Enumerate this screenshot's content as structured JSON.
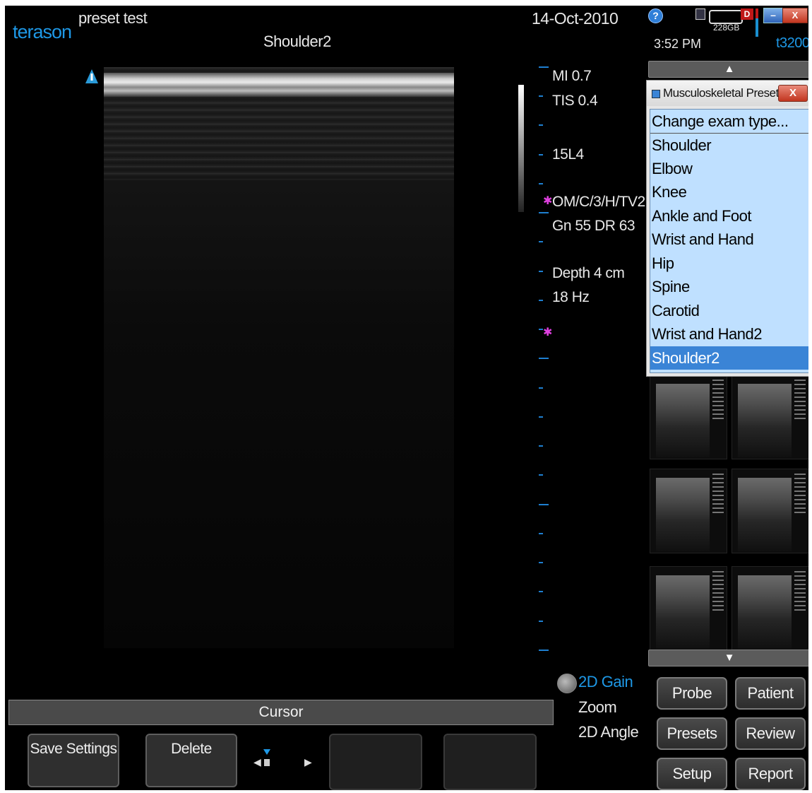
{
  "header": {
    "logo": "terason",
    "preset_name": "preset test",
    "exam_name": "Shoulder2",
    "date": "14-Oct-2010",
    "time": "3:52 PM",
    "storage": "228GB",
    "model": "t3200"
  },
  "info": {
    "mi": "MI  0.7",
    "tis": "TIS 0.4",
    "probe": "15L4",
    "mode": "OM/C/3/H/TV2",
    "gain": "Gn 55  DR 63",
    "depth": "Depth 4 cm",
    "frame_rate": "18 Hz"
  },
  "presets_dialog": {
    "title": "Musculoskeletal Presets",
    "close": "X",
    "items": [
      "Change exam type...",
      "Shoulder",
      "Elbow",
      "Knee",
      "Ankle and Foot",
      "Wrist and Hand",
      "Hip",
      "Spine",
      "Carotid",
      "Wrist and Hand2",
      "Shoulder2"
    ],
    "selected": "Shoulder2"
  },
  "controls": {
    "cursor": "Cursor",
    "save_settings": "Save Settings",
    "delete": "Delete",
    "gain_2d": "2D Gain",
    "zoom": "Zoom",
    "angle_2d": "2D Angle"
  },
  "nav_buttons": {
    "probe": "Probe",
    "patient": "Patient",
    "presets": "Presets",
    "review": "Review",
    "setup": "Setup",
    "report": "Report"
  },
  "colors": {
    "accent": "#1e98e6",
    "selection": "#3a84d6",
    "list_bg": "#bfe0ff"
  }
}
